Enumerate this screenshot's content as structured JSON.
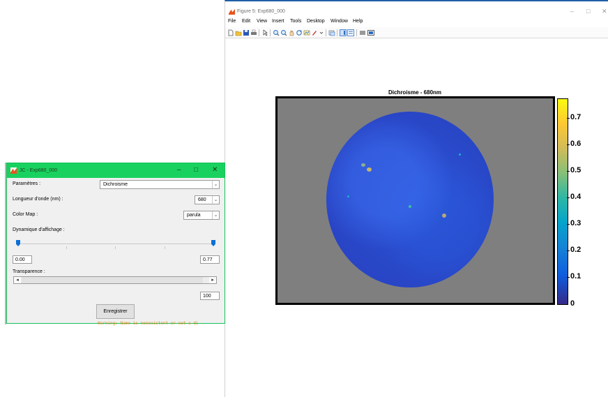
{
  "figure_window": {
    "title": "Figure 5: Exp680_000",
    "controls": {
      "minimize": "–",
      "maximize": "□",
      "close": "✕"
    },
    "menu": [
      "File",
      "Edit",
      "View",
      "Insert",
      "Tools",
      "Desktop",
      "Window",
      "Help"
    ],
    "toolbar_icons": [
      "new-figure-icon",
      "open-file-icon",
      "save-icon",
      "print-icon",
      "pointer-icon",
      "zoom-in-icon",
      "zoom-out-icon",
      "pan-icon",
      "rotate-icon",
      "data-cursor-icon",
      "brush-icon",
      "link-plot-icon",
      "colorbar-icon",
      "legend-icon",
      "hide-plot-tools-icon",
      "show-plot-tools-icon"
    ]
  },
  "plot": {
    "title": "Dichroisme - 680nm",
    "colorbar": {
      "colormap": "parula",
      "ticks": [
        "0.7",
        "0.6",
        "0.5",
        "0.4",
        "0.3",
        "0.2",
        "0.1",
        "0"
      ]
    }
  },
  "control_window": {
    "title": "JC - Exp680_000",
    "controls": {
      "minimize": "–",
      "maximize": "□",
      "close": "✕"
    },
    "parametres": {
      "label": "Paramètres :",
      "value": "Dichroisme"
    },
    "longueur": {
      "label": "Longueur d'onde (nm) :",
      "value": "680"
    },
    "colormap": {
      "label": "Color Map :",
      "value": "parula"
    },
    "dynamique": {
      "label": "Dynamique d'affichage :",
      "min": "0.00",
      "max": "0.77"
    },
    "transparence": {
      "label": "Transparence :",
      "value": "100"
    },
    "save_label": "Enregistrer"
  },
  "command_window_fragment": "Warning: Name is nonexistent or not a di"
}
